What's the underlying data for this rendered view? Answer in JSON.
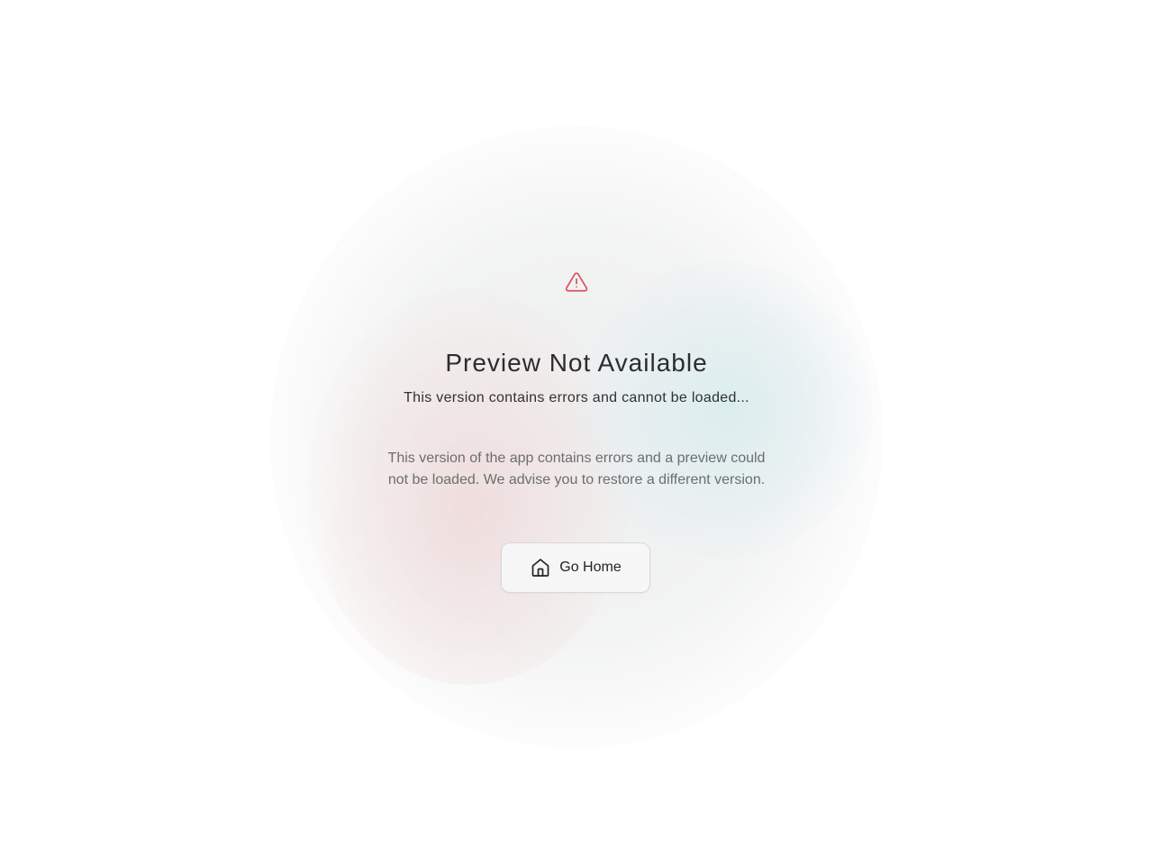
{
  "error": {
    "icon": "warning-triangle-icon",
    "title": "Preview Not Available",
    "subtitle": "This version contains errors and cannot be loaded...",
    "description": "This version of the app contains errors and a preview could not be loaded. We advise you to restore a different version."
  },
  "actions": {
    "home_icon": "home-icon",
    "home_label": "Go Home"
  },
  "colors": {
    "warning": "#d9535f",
    "text_primary": "#2b2d2e",
    "text_secondary": "#6b6e70"
  }
}
